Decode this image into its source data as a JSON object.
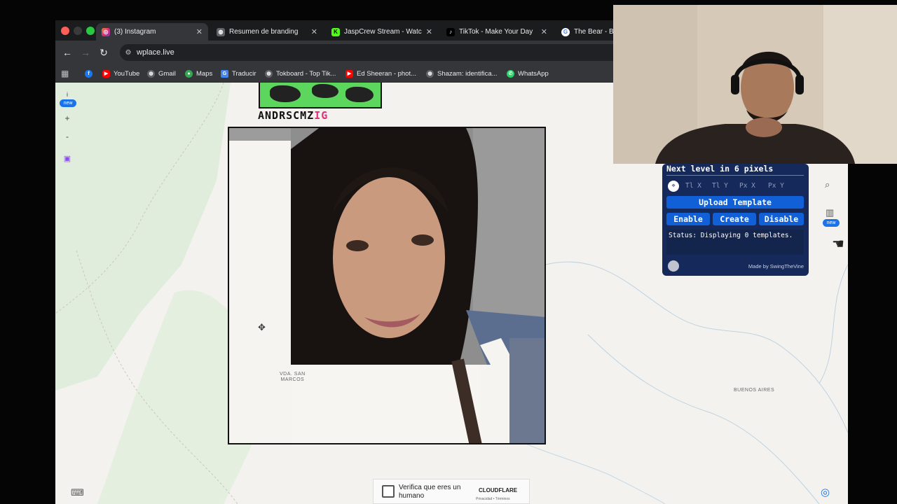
{
  "tabs": [
    {
      "title": "(3) Instagram",
      "icon": "instagram-icon",
      "active": true
    },
    {
      "title": "Resumen de branding",
      "icon": "globe-icon",
      "active": false
    },
    {
      "title": "JaspCrew Stream - Watch",
      "icon": "kick-icon",
      "active": false
    },
    {
      "title": "TikTok - Make Your Day",
      "icon": "tiktok-icon",
      "active": false
    },
    {
      "title": "The Bear - Bu",
      "icon": "google-icon",
      "active": false
    }
  ],
  "address": {
    "url": "wplace.live"
  },
  "bookmarks": [
    {
      "label": "YouTube",
      "icon": "youtube-icon"
    },
    {
      "label": "Gmail",
      "icon": "globe-icon"
    },
    {
      "label": "Maps",
      "icon": "maps-icon"
    },
    {
      "label": "Traducir",
      "icon": "translate-icon"
    },
    {
      "label": "Tokboard - Top Tik...",
      "icon": "globe-icon"
    },
    {
      "label": "Ed Sheeran - phot...",
      "icon": "youtube-icon"
    },
    {
      "label": "Shazam: identifica...",
      "icon": "globe-icon"
    },
    {
      "label": "WhatsApp",
      "icon": "whatsapp-icon"
    }
  ],
  "map_controls": {
    "info": "i",
    "new_badge": "new",
    "zoom_in": "+",
    "zoom_out": "-"
  },
  "canvas": {
    "banner_text": "ANDRSCMZ",
    "banner_badge": "IG",
    "place_label_1": "VDA. SAN\nMARCOS",
    "place_label_2": "BUENOS AIRES"
  },
  "captcha": {
    "label": "Verifica que eres un humano",
    "brand": "CLOUDFLARE",
    "links": "Privacidad • Términos"
  },
  "template_panel": {
    "level_text": "Next level in 6 pixels",
    "coords": [
      "Tl X",
      "Tl Y",
      "Px X",
      "Px Y"
    ],
    "upload_label": "Upload Template",
    "enable_label": "Enable",
    "create_label": "Create",
    "disable_label": "Disable",
    "status_text": "Status: Displaying 0 templates.",
    "credit": "Made by SwingTheVine"
  },
  "right_controls": {
    "new_badge": "new"
  },
  "colors": {
    "accent": "#1160d8",
    "panel_bg": "#152a5a",
    "map_bg": "#f3f2ef",
    "banner_green": "#5cd65c"
  }
}
